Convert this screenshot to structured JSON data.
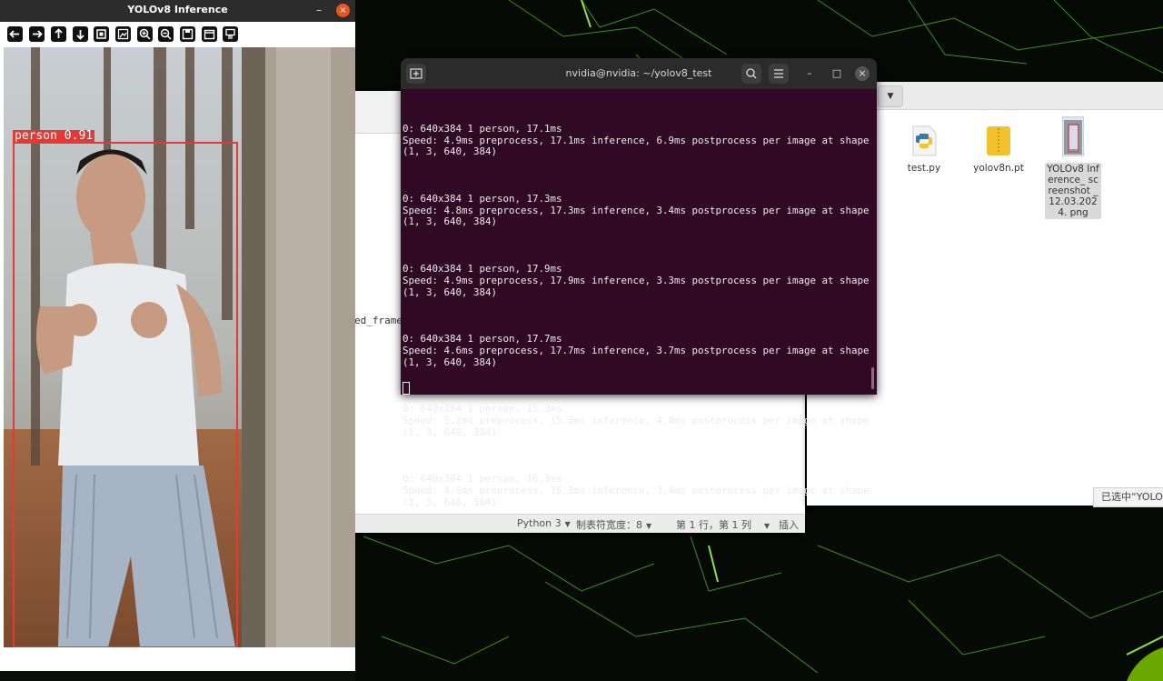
{
  "yolo_window": {
    "title": "YOLOv8 Inference",
    "minimize_glyph": "–",
    "close_glyph": "×",
    "toolbar": [
      "arrow-left-icon",
      "arrow-right-icon",
      "arrow-up-icon",
      "arrow-down-icon",
      "zoom-fit-icon",
      "zoom-region-icon",
      "zoom-in-icon",
      "zoom-out-icon",
      "save-icon",
      "properties-icon",
      "expanded-panel-icon"
    ],
    "detection": {
      "label": "person 0.91",
      "class": "person",
      "confidence": 0.91
    }
  },
  "terminal": {
    "title": "nvidia@nvidia: ~/yolov8_test",
    "lines": [
      {
        "head": "0: 640x384 1 person, 17.1ms",
        "speed": "Speed: 4.9ms preprocess, 17.1ms inference, 6.9ms postprocess per image at shape",
        "shape": "(1, 3, 640, 384)"
      },
      {
        "head": "0: 640x384 1 person, 17.3ms",
        "speed": "Speed: 4.8ms preprocess, 17.3ms inference, 3.4ms postprocess per image at shape",
        "shape": "(1, 3, 640, 384)"
      },
      {
        "head": "0: 640x384 1 person, 17.9ms",
        "speed": "Speed: 4.9ms preprocess, 17.9ms inference, 3.3ms postprocess per image at shape",
        "shape": "(1, 3, 640, 384)"
      },
      {
        "head": "0: 640x384 1 person, 17.7ms",
        "speed": "Speed: 4.6ms preprocess, 17.7ms inference, 3.7ms postprocess per image at shape",
        "shape": "(1, 3, 640, 384)"
      },
      {
        "head": "0: 640x384 1 person, 15.3ms",
        "speed": "Speed: 5.2ms preprocess, 15.3ms inference, 4.8ms postprocess per image at shape",
        "shape": "(1, 3, 640, 384)"
      },
      {
        "head": "0: 640x384 1 person, 16.3ms",
        "speed": "Speed: 4.9ms preprocess, 16.3ms inference, 3.4ms postprocess per image at shape",
        "shape": "(1, 3, 640, 384)"
      }
    ]
  },
  "editor": {
    "partial_text": "ed_frame",
    "status": {
      "language": "Python 3",
      "tab_width": "制表符宽度：8",
      "position": "第 1 行，第 1 列",
      "mode": "插入"
    }
  },
  "files": {
    "items": [
      {
        "name": "test.py",
        "icon": "python-file-icon"
      },
      {
        "name": "yolov8n.pt",
        "icon": "archive-file-icon"
      },
      {
        "name": "YOLOv8 Inference_ screenshot _ 12.03.2024. png",
        "icon": "image-thumbnail-icon",
        "selected": true
      }
    ],
    "status_text": "已选中“YOLOv"
  },
  "colors": {
    "terminal_bg": "#300a24",
    "bbox": "#e53935",
    "ubuntu_orange": "#e95420"
  }
}
